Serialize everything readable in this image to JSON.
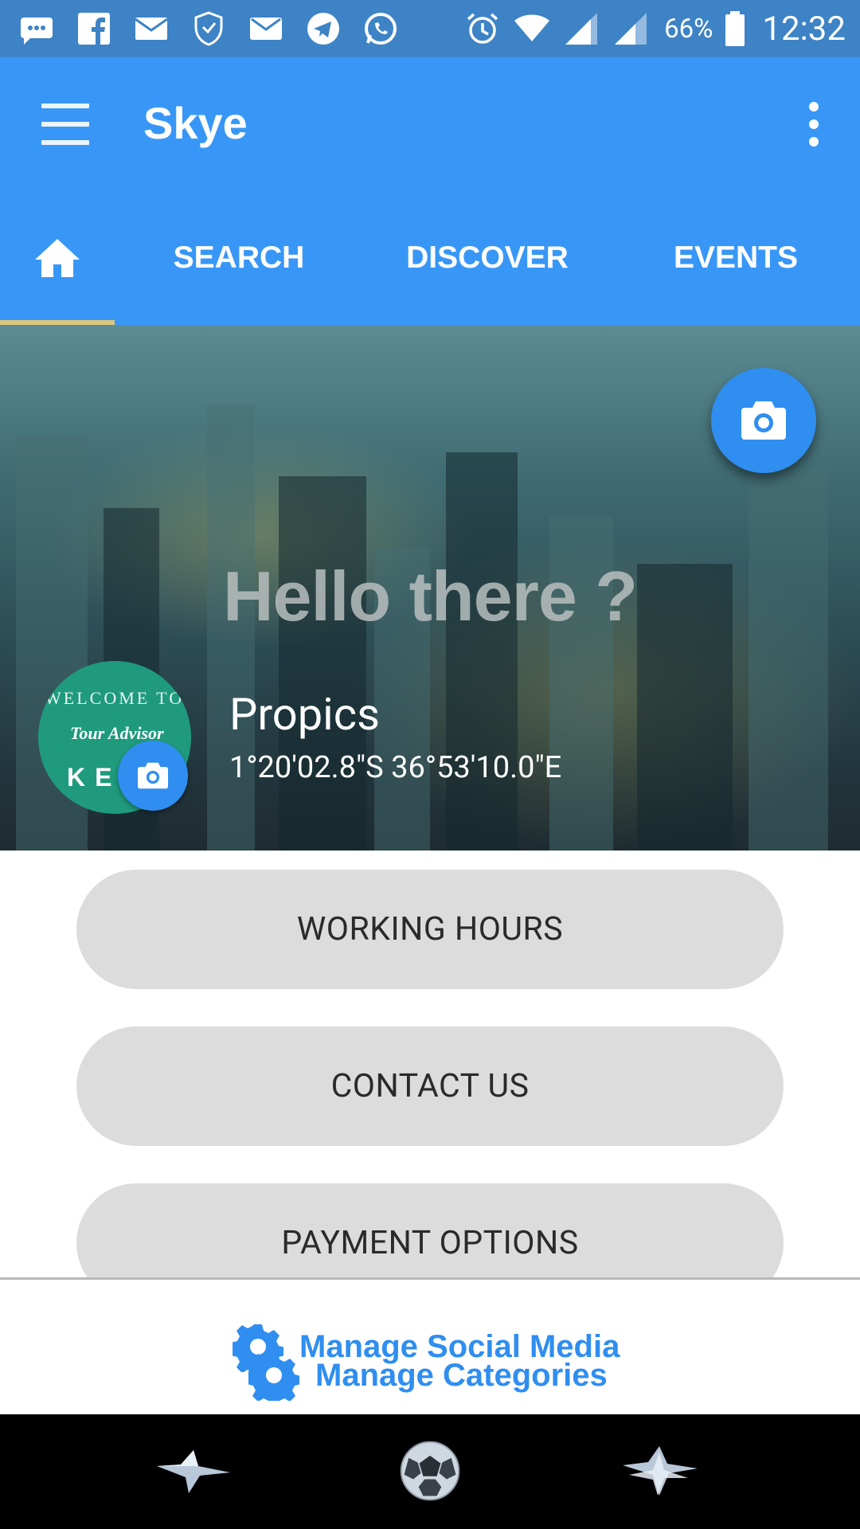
{
  "status_bar": {
    "notification_icons": [
      "messages-icon",
      "facebook-icon",
      "gmail-icon",
      "shield-icon",
      "email-icon",
      "telegram-icon",
      "whatsapp-icon"
    ],
    "system_icons": [
      "alarm-icon",
      "wifi-icon",
      "signal-icon",
      "signal-icon",
      "battery-icon"
    ],
    "battery": "66%",
    "time": "12:32"
  },
  "app_bar": {
    "title": "Skye",
    "menu_icon": "hamburger-menu-icon",
    "overflow_icon": "more-vertical-icon",
    "color": "#3897f6"
  },
  "tabs": {
    "items": [
      {
        "label": "",
        "icon": "home-icon",
        "selected": true
      },
      {
        "label": "SEARCH",
        "selected": false
      },
      {
        "label": "DISCOVER",
        "selected": false
      },
      {
        "label": "EVENTS",
        "selected": false
      }
    ],
    "indicator_color": "#dcc87a"
  },
  "hero": {
    "greeting": "Hello there ?",
    "camera_icon": "camera-icon",
    "business_name": "Propics",
    "coordinates": "1°20'02.8\"S 36°53'10.0\"E",
    "avatar": {
      "line1": "WELCOME TO",
      "line2": "Tour Advisor",
      "line3": "KENYA",
      "camera_icon": "camera-icon"
    }
  },
  "actions": {
    "working_hours": "WORKING HOURS",
    "contact_us": "CONTACT US",
    "payment_options": "PAYMENT OPTIONS"
  },
  "manage": {
    "social_media": "Manage Social Media",
    "categories": "Manage Categories",
    "icon": "gear-icon",
    "color": "#2f8ef0"
  },
  "bottom_bar": {
    "items": [
      "star-icon",
      "soccer-ball-icon",
      "star-icon"
    ]
  }
}
